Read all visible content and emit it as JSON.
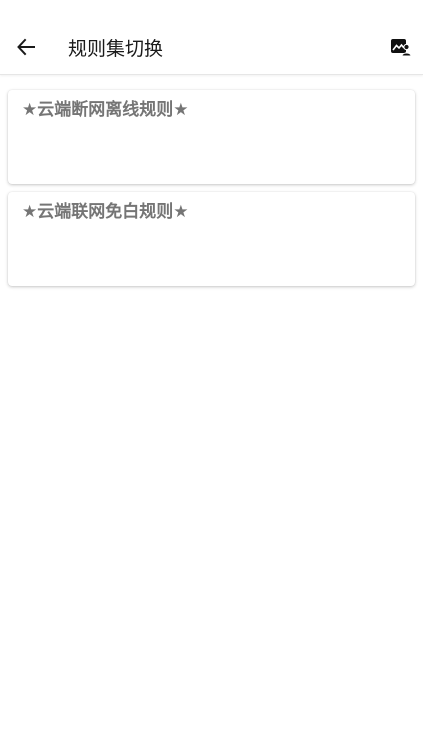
{
  "header": {
    "title": "规则集切换",
    "back_icon": "arrow-left-icon",
    "action_icon": "image-person-icon"
  },
  "rules": [
    {
      "label": "★云端断网离线规则★"
    },
    {
      "label": "★云端联网免白规则★"
    }
  ],
  "colors": {
    "background": "#ffffff",
    "title_text": "#1a1a1a",
    "card_text": "#757575"
  }
}
